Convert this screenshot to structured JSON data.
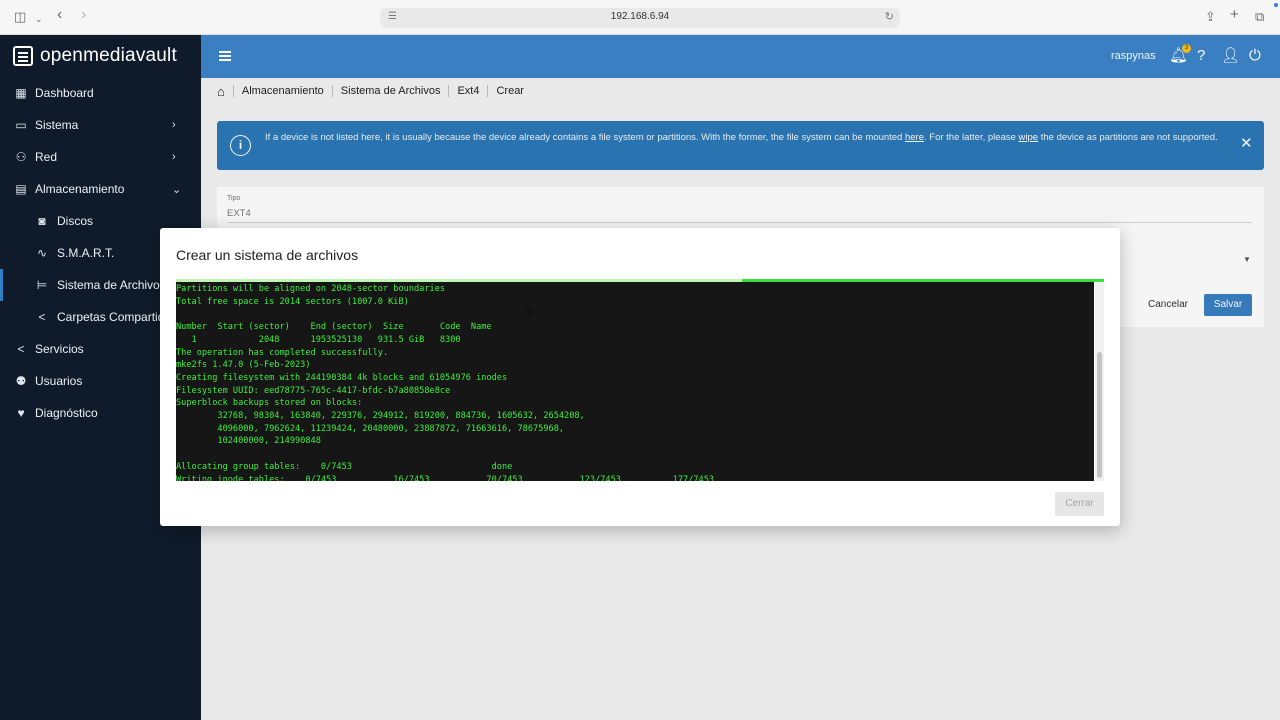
{
  "browser": {
    "url": "192.168.6.94",
    "icons": {
      "sidebar_toggle": "sidebar-icon",
      "back": "chevron-left-icon",
      "forward": "chevron-right-icon",
      "reload": "reload-icon",
      "share": "share-icon",
      "new_tab": "plus-icon",
      "tabs": "tabs-icon"
    }
  },
  "sidebar": {
    "logo_text": "openmediavault",
    "items": [
      {
        "label": "Dashboard",
        "icon": "grid-icon"
      },
      {
        "label": "Sistema",
        "icon": "laptop-icon"
      },
      {
        "label": "Red",
        "icon": "network-icon"
      },
      {
        "label": "Almacenamiento",
        "icon": "storage-icon"
      },
      {
        "label": "Discos",
        "icon": "disk-icon"
      },
      {
        "label": "S.M.A.R.T.",
        "icon": "pulse-icon"
      },
      {
        "label": "Sistema de Archivos",
        "icon": "tree-icon"
      },
      {
        "label": "Carpetas Compartidas",
        "icon": "share-icon"
      },
      {
        "label": "Servicios",
        "icon": "share-nodes-icon"
      },
      {
        "label": "Usuarios",
        "icon": "users-icon"
      },
      {
        "label": "Diagnóstico",
        "icon": "heart-pulse-icon"
      }
    ]
  },
  "header": {
    "username": "raspynas",
    "notification_count": "3"
  },
  "breadcrumb": {
    "items": [
      "Almacenamiento",
      "Sistema de Archivos",
      "Ext4",
      "Crear"
    ]
  },
  "info_banner": {
    "text_before_here": "If a device is not listed here, it is usually because the device already contains a file system or partitions. With the former, the file system can be mounted ",
    "link_here": "here",
    "text_middle": ". For the latter, please ",
    "link_wipe": "wipe",
    "text_after": " the device as partitions are not supported."
  },
  "form": {
    "type_label": "Tipo",
    "type_value": "EXT4",
    "cancel_label": "Cancelar",
    "save_label": "Salvar"
  },
  "modal": {
    "title": "Crear un sistema de archivos",
    "progress": 0.39,
    "close_label": "Cerrar",
    "terminal_output": "Partitions will be aligned on 2048-sector boundaries\nTotal free space is 2014 sectors (1007.0 KiB)\n\nNumber  Start (sector)    End (sector)  Size       Code  Name\n   1            2048      1953525130   931.5 GiB   8300\nThe operation has completed successfully.\nmke2fs 1.47.0 (5-Feb-2023)\nCreating filesystem with 244190384 4k blocks and 61054976 inodes\nFilesystem UUID: eed78775-765c-4417-bfdc-b7a80858e8ce\nSuperblock backups stored on blocks:\n        32768, 98304, 163840, 229376, 294912, 819200, 884736, 1605632, 2654208,\n        4096000, 7962624, 11239424, 20480000, 23887872, 71663616, 78675968,\n        102400000, 214990848\n\nAllocating group tables:    0/7453                           done\nWriting inode tables:    0/7453           16/7453           70/7453           123/7453          177/7453"
  }
}
